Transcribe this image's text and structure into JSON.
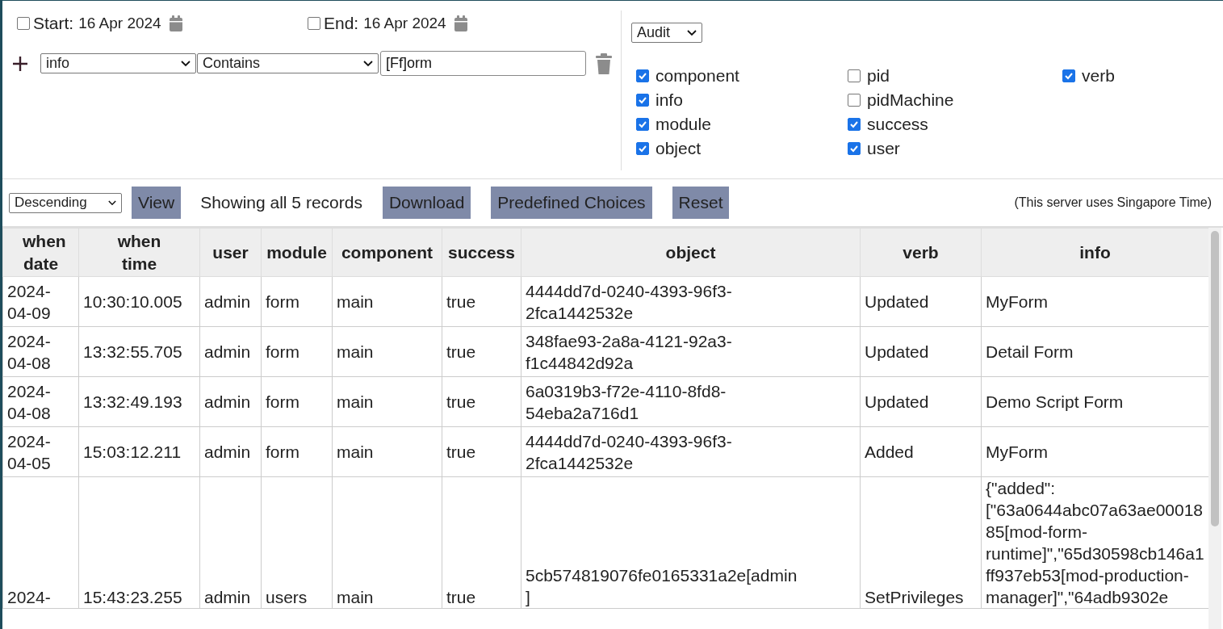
{
  "date_filters": [
    {
      "label": "Start:",
      "checked": false,
      "value": "16 Apr 2024"
    },
    {
      "label": "End:",
      "checked": false,
      "value": "16 Apr 2024"
    }
  ],
  "condition": {
    "field": "info",
    "operator": "Contains",
    "value": "[Ff]orm"
  },
  "log_type": "Audit",
  "columns_picker": [
    {
      "label": "component",
      "checked": true
    },
    {
      "label": "info",
      "checked": true
    },
    {
      "label": "module",
      "checked": true
    },
    {
      "label": "object",
      "checked": true
    },
    {
      "label": "pid",
      "checked": false
    },
    {
      "label": "pidMachine",
      "checked": false
    },
    {
      "label": "success",
      "checked": true
    },
    {
      "label": "user",
      "checked": true
    },
    {
      "label": "verb",
      "checked": true
    }
  ],
  "toolbar": {
    "sort": "Descending",
    "view_button": "View",
    "status": "Showing all 5 records",
    "buttons": [
      "Download",
      "Predefined Choices",
      "Reset"
    ],
    "timezone_note": "(This server uses Singapore Time)"
  },
  "table": {
    "columns": [
      "when date",
      "when time",
      "user",
      "module",
      "component",
      "success",
      "object",
      "verb",
      "info"
    ],
    "rows": [
      [
        "2024-04-09",
        "10:30:10.005",
        "admin",
        "form",
        "main",
        "true",
        "4444dd7d-0240-4393-96f3-2fca1442532e",
        "Updated",
        "MyForm"
      ],
      [
        "2024-04-08",
        "13:32:55.705",
        "admin",
        "form",
        "main",
        "true",
        "348fae93-2a8a-4121-92a3-f1c44842d92a",
        "Updated",
        "Detail Form"
      ],
      [
        "2024-04-08",
        "13:32:49.193",
        "admin",
        "form",
        "main",
        "true",
        "6a0319b3-f72e-4110-8fd8-54eba2a716d1",
        "Updated",
        "Demo Script Form"
      ],
      [
        "2024-04-05",
        "15:03:12.211",
        "admin",
        "form",
        "main",
        "true",
        "4444dd7d-0240-4393-96f3-2fca1442532e",
        "Added",
        "MyForm"
      ],
      [
        "2024-",
        "15:43:23.255",
        "admin",
        "users",
        "main",
        "true",
        "5cb574819076fe0165331a2e[admin]",
        "SetPrivileges",
        "{\"added\":[\"63a0644abc07a63ae0001885[mod-form-runtime]\",\"65d30598cb146a1ff937eb53[mod-production-manager]\",\"64adb9302e"
      ]
    ]
  }
}
